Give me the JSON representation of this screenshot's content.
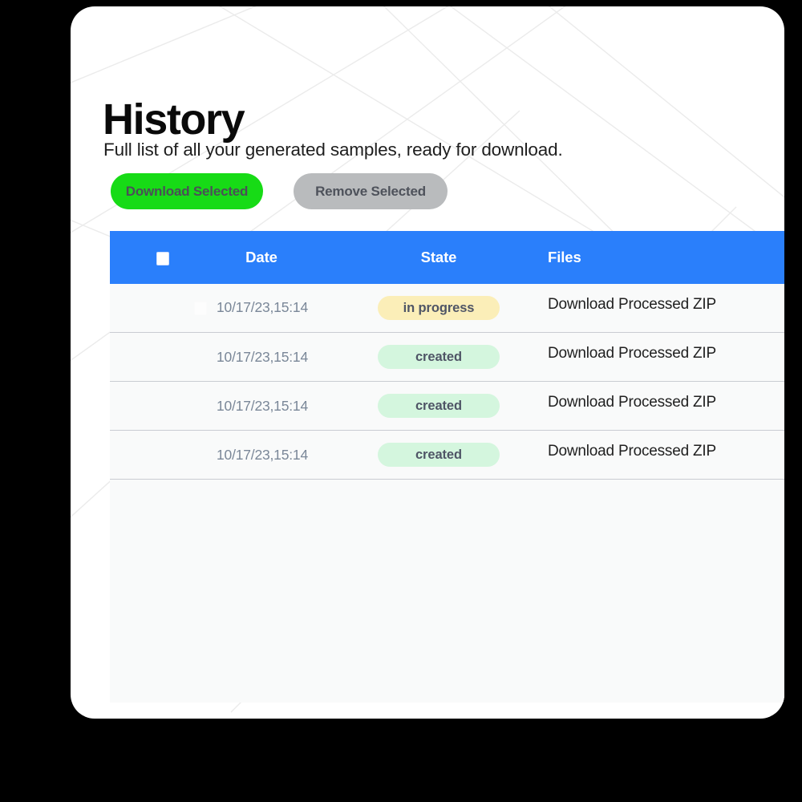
{
  "page": {
    "title": "History",
    "subtitle": "Full list of all your generated samples, ready for download."
  },
  "toolbar": {
    "download_label": "Download Selected",
    "remove_label": "Remove Selected",
    "download_color": "#17db16",
    "remove_color": "#b9bbbd"
  },
  "table": {
    "header_color": "#2a7ffb",
    "columns": {
      "select": "",
      "date": "Date",
      "state": "State",
      "files": "Files"
    },
    "rows": [
      {
        "selected": false,
        "checkbox_visible": true,
        "date": "10/17/23,15:14",
        "state": "in progress",
        "state_kind": "in-progress",
        "state_bg": "#fbeeb8",
        "files": "Download Processed ZIP"
      },
      {
        "selected": false,
        "checkbox_visible": false,
        "date": "10/17/23,15:14",
        "state": "created",
        "state_kind": "created",
        "state_bg": "#d4f6de",
        "files": "Download Processed ZIP"
      },
      {
        "selected": false,
        "checkbox_visible": false,
        "date": "10/17/23,15:14",
        "state": "created",
        "state_kind": "created",
        "state_bg": "#d4f6de",
        "files": "Download Processed ZIP"
      },
      {
        "selected": false,
        "checkbox_visible": false,
        "date": "10/17/23,15:14",
        "state": "created",
        "state_kind": "created",
        "state_bg": "#d4f6de",
        "files": "Download Processed ZIP"
      }
    ]
  }
}
